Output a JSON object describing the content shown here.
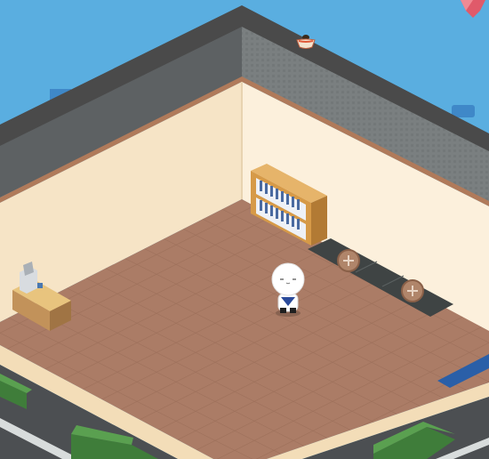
{
  "scene": {
    "kind": "isometric-room",
    "colors": {
      "sky": "#5aaee0",
      "roof": "#4a4a4a",
      "wall_upper": "#7a7f80",
      "wall_inner": "#f8e9d0",
      "trim": "#b07a5a",
      "floor": "#ab7c66",
      "floor_grid": "#9a6d58",
      "slot_dark": "#3f4444",
      "slot_button": "#b0856a",
      "hedge": "#3f7d3a",
      "blue_mat": "#2a5fa8"
    }
  },
  "icons": {
    "wall_item": "ramen-bowl-icon",
    "top_right": "red-gem-icon",
    "add": "plus-icon"
  },
  "furniture": {
    "bookshelf": "bookshelf",
    "counter": "reception-counter",
    "register": "cash-register"
  },
  "slots": [
    {
      "name": "add-slot-1",
      "icon": "plus-icon"
    },
    {
      "name": "add-slot-2",
      "icon": "plus-icon"
    }
  ]
}
